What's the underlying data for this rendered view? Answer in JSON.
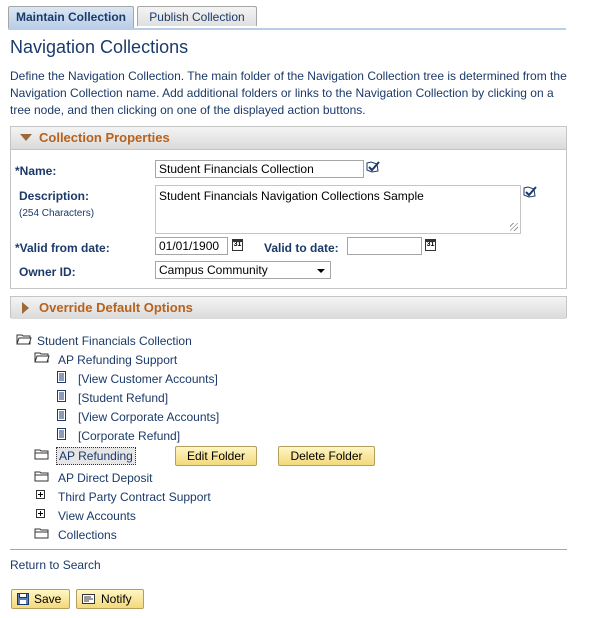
{
  "tabs": [
    {
      "label": "Maintain Collection",
      "active": true
    },
    {
      "label": "Publish Collection",
      "active": false
    }
  ],
  "page_title": "Navigation Collections",
  "description": "Define the Navigation Collection. The main folder of the Navigation Collection tree is determined from the Navigation Collection name. Add additional folders or links to the Navigation Collection by clicking on a tree node, and then clicking on one of the displayed action buttons.",
  "collection_properties": {
    "header": "Collection Properties",
    "name_label": "*Name:",
    "name_value": "Student Financials Collection",
    "description_label": "Description:",
    "description_hint": "(254 Characters)",
    "description_value": "Student Financials Navigation Collections Sample",
    "valid_from_label": "*Valid from date:",
    "valid_from_value": "01/01/1900",
    "valid_to_label": "Valid to date:",
    "valid_to_value": "",
    "owner_label": "Owner ID:",
    "owner_value": "Campus Community"
  },
  "override_header": "Override Default Options",
  "tree": {
    "root": "Student Financials Collection",
    "folder_open": "AP Refunding Support",
    "links": [
      "[View Customer Accounts]",
      "[Student Refund]",
      "[View Corporate Accounts]",
      "[Corporate Refund]"
    ],
    "selected_folder": "AP Refunding",
    "edit_folder": "Edit Folder",
    "delete_folder": "Delete Folder",
    "ap_direct_deposit": "AP Direct Deposit",
    "third_party": "Third Party Contract Support",
    "view_accounts": "View Accounts",
    "collections": "Collections"
  },
  "return_to_search": "Return to Search",
  "toolbar": {
    "save_label": "Save",
    "notify_label": "Notify"
  },
  "colors": {
    "accent": "#1b3a69",
    "group_header": "#b7621c",
    "button": "#f3d97b"
  }
}
